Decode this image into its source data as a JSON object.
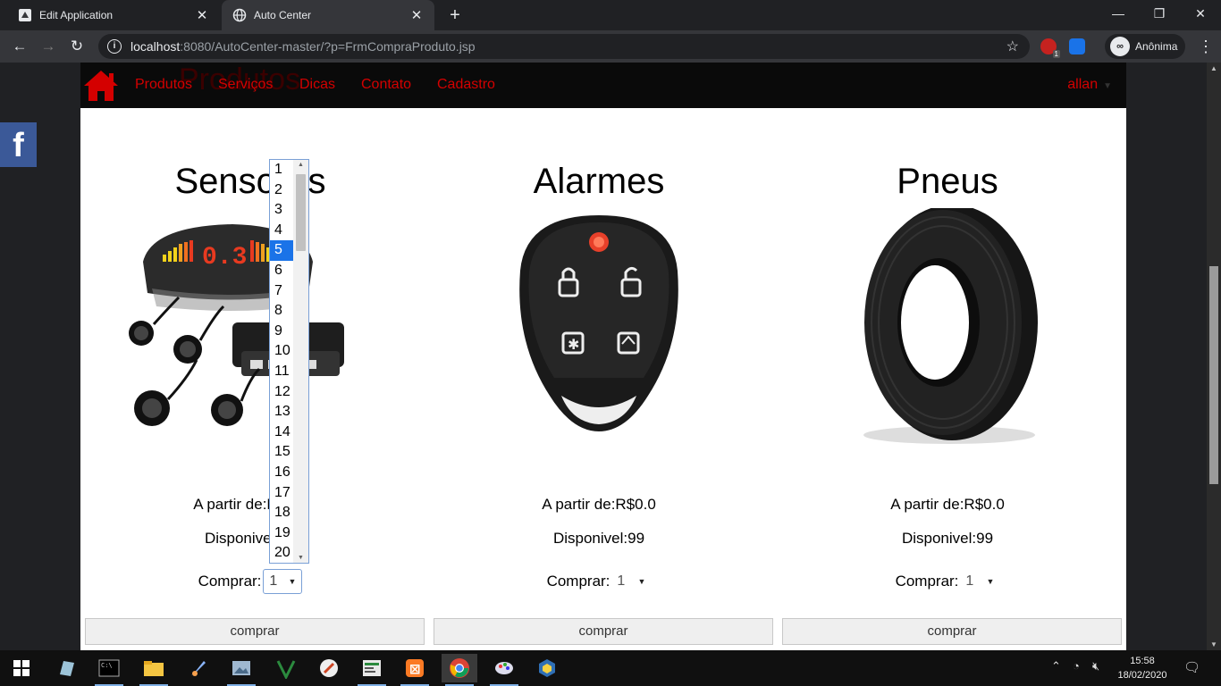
{
  "browser": {
    "tabs": [
      {
        "title": "Edit Application",
        "active": false
      },
      {
        "title": "Auto Center",
        "active": true
      }
    ],
    "address": {
      "host": "localhost",
      "path": ":8080/AutoCenter-master/?p=FrmCompraProduto.jsp"
    },
    "profile_label": "Anônima",
    "extension_badge": "1"
  },
  "site": {
    "ghost_title": "Produtos",
    "nav": [
      "Produtos",
      "Serviços",
      "Dicas",
      "Contato",
      "Cadastro"
    ],
    "user": "allan",
    "facebook_label": "f"
  },
  "products": [
    {
      "name": "Sensores",
      "price": "A partir de:R$0.0",
      "stock": "Disponivel:99",
      "buy_label": "Comprar:",
      "qty": "1",
      "button": "comprar",
      "image_icon": "parking-sensor-kit-image"
    },
    {
      "name": "Alarmes",
      "price": "A partir de:R$0.0",
      "stock": "Disponivel:99",
      "buy_label": "Comprar:",
      "qty": "1",
      "button": "comprar",
      "image_icon": "car-alarm-remote-image"
    },
    {
      "name": "Pneus",
      "price": "A partir de:R$0.0",
      "stock": "Disponivel:99",
      "buy_label": "Comprar:",
      "qty": "1",
      "button": "comprar",
      "image_icon": "tire-image"
    }
  ],
  "dropdown": {
    "options": [
      "1",
      "2",
      "3",
      "4",
      "5",
      "6",
      "7",
      "8",
      "9",
      "10",
      "11",
      "12",
      "13",
      "14",
      "15",
      "16",
      "17",
      "18",
      "19",
      "20"
    ],
    "highlighted": "5"
  },
  "taskbar": {
    "time": "15:58",
    "date": "18/02/2020"
  },
  "colors": {
    "nav_link": "#d40000",
    "facebook": "#3b5998",
    "selection": "#1a73e8"
  }
}
